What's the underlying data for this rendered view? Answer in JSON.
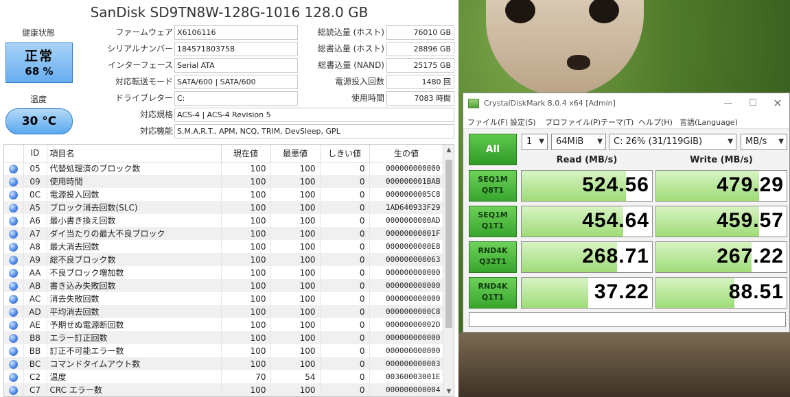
{
  "cdi": {
    "title": "SanDisk SD9TN8W-128G-1016 128.0 GB",
    "health_label": "健康状態",
    "health_status": "正常",
    "health_pct": "68 %",
    "temp_label": "温度",
    "temp_value": "30 °C",
    "info": {
      "firmware_label": "ファームウェア",
      "firmware": "X6106116",
      "serial_label": "シリアルナンバー",
      "serial": "184571803758",
      "interface_label": "インターフェース",
      "interface": "Serial ATA",
      "transfer_label": "対応転送モード",
      "transfer": "SATA/600 | SATA/600",
      "drive_label": "ドライブレター",
      "drive": "C:",
      "standard_label": "対応規格",
      "standard": "ACS-4 | ACS-4 Revision 5",
      "features_label": "対応機能",
      "features": "S.M.A.R.T., APM, NCQ, TRIM, DevSleep, GPL",
      "host_reads_label": "総読込量 (ホスト)",
      "host_reads": "76010 GB",
      "host_writes_label": "総書込量 (ホスト)",
      "host_writes": "28896 GB",
      "nand_writes_label": "総書込量 (NAND)",
      "nand_writes": "25175 GB",
      "power_count_label": "電源投入回数",
      "power_count": "1480 回",
      "power_hours_label": "使用時間",
      "power_hours": "7083 時間"
    },
    "table_headers": [
      "ID",
      "項目名",
      "現在値",
      "最悪値",
      "しきい値",
      "生の値"
    ],
    "attributes": [
      {
        "id": "05",
        "name": "代替処理済のブロック数",
        "cur": "100",
        "worst": "100",
        "thr": "0",
        "raw": "000000000000"
      },
      {
        "id": "09",
        "name": "使用時間",
        "cur": "100",
        "worst": "100",
        "thr": "0",
        "raw": "000000001BAB"
      },
      {
        "id": "0C",
        "name": "電源投入回数",
        "cur": "100",
        "worst": "100",
        "thr": "0",
        "raw": "0000000005C8"
      },
      {
        "id": "A5",
        "name": "ブロック消去回数(SLC)",
        "cur": "100",
        "worst": "100",
        "thr": "0",
        "raw": "1AD640933F29"
      },
      {
        "id": "A6",
        "name": "最小書き換え回数",
        "cur": "100",
        "worst": "100",
        "thr": "0",
        "raw": "0000000000AD"
      },
      {
        "id": "A7",
        "name": "ダイ当たりの最大不良ブロック",
        "cur": "100",
        "worst": "100",
        "thr": "0",
        "raw": "00000000001F"
      },
      {
        "id": "A8",
        "name": "最大消去回数",
        "cur": "100",
        "worst": "100",
        "thr": "0",
        "raw": "0000000000E8"
      },
      {
        "id": "A9",
        "name": "総不良ブロック数",
        "cur": "100",
        "worst": "100",
        "thr": "0",
        "raw": "000000000063"
      },
      {
        "id": "AA",
        "name": "不良ブロック増加数",
        "cur": "100",
        "worst": "100",
        "thr": "0",
        "raw": "000000000000"
      },
      {
        "id": "AB",
        "name": "書き込み失敗回数",
        "cur": "100",
        "worst": "100",
        "thr": "0",
        "raw": "000000000000"
      },
      {
        "id": "AC",
        "name": "消去失敗回数",
        "cur": "100",
        "worst": "100",
        "thr": "0",
        "raw": "000000000000"
      },
      {
        "id": "AD",
        "name": "平均消去回数",
        "cur": "100",
        "worst": "100",
        "thr": "0",
        "raw": "0000000000C8"
      },
      {
        "id": "AE",
        "name": "予期せぬ電源断回数",
        "cur": "100",
        "worst": "100",
        "thr": "0",
        "raw": "00000000002D"
      },
      {
        "id": "B8",
        "name": "エラー訂正回数",
        "cur": "100",
        "worst": "100",
        "thr": "0",
        "raw": "000000000000"
      },
      {
        "id": "BB",
        "name": "訂正不可能エラー数",
        "cur": "100",
        "worst": "100",
        "thr": "0",
        "raw": "000000000000"
      },
      {
        "id": "BC",
        "name": "コマンドタイムアウト数",
        "cur": "100",
        "worst": "100",
        "thr": "0",
        "raw": "000000000003"
      },
      {
        "id": "C2",
        "name": "温度",
        "cur": "70",
        "worst": "54",
        "thr": "0",
        "raw": "00360003001E"
      },
      {
        "id": "C7",
        "name": "CRC エラー数",
        "cur": "100",
        "worst": "100",
        "thr": "0",
        "raw": "000000000004"
      }
    ]
  },
  "cdm": {
    "title": "CrystalDiskMark 8.0.4 x64 [Admin]",
    "menu": [
      "ファイル(F)",
      "設定(S)",
      "プロファイル(P)",
      "テーマ(T)",
      "ヘルプ(H)",
      "言語(Language)"
    ],
    "all_label": "All",
    "count": "1",
    "size": "64MiB",
    "drive": "C: 26% (31/119GiB)",
    "unit": "MB/s",
    "read_header": "Read (MB/s)",
    "write_header": "Write (MB/s)",
    "tests": [
      {
        "line1": "SEQ1M",
        "line2": "Q8T1",
        "read": "524.56",
        "write": "479.29",
        "read_fill": 0.8,
        "write_fill": 0.79
      },
      {
        "line1": "SEQ1M",
        "line2": "Q1T1",
        "read": "454.64",
        "write": "459.57",
        "read_fill": 0.78,
        "write_fill": 0.79
      },
      {
        "line1": "RND4K",
        "line2": "Q32T1",
        "read": "268.71",
        "write": "267.22",
        "read_fill": 0.73,
        "write_fill": 0.73
      },
      {
        "line1": "RND4K",
        "line2": "Q1T1",
        "read": "37.22",
        "write": "88.51",
        "read_fill": 0.51,
        "write_fill": 0.6
      }
    ]
  },
  "icons": {
    "window_minimize": "minimize-icon",
    "window_maximize": "maximize-icon",
    "window_close": "close-icon"
  }
}
